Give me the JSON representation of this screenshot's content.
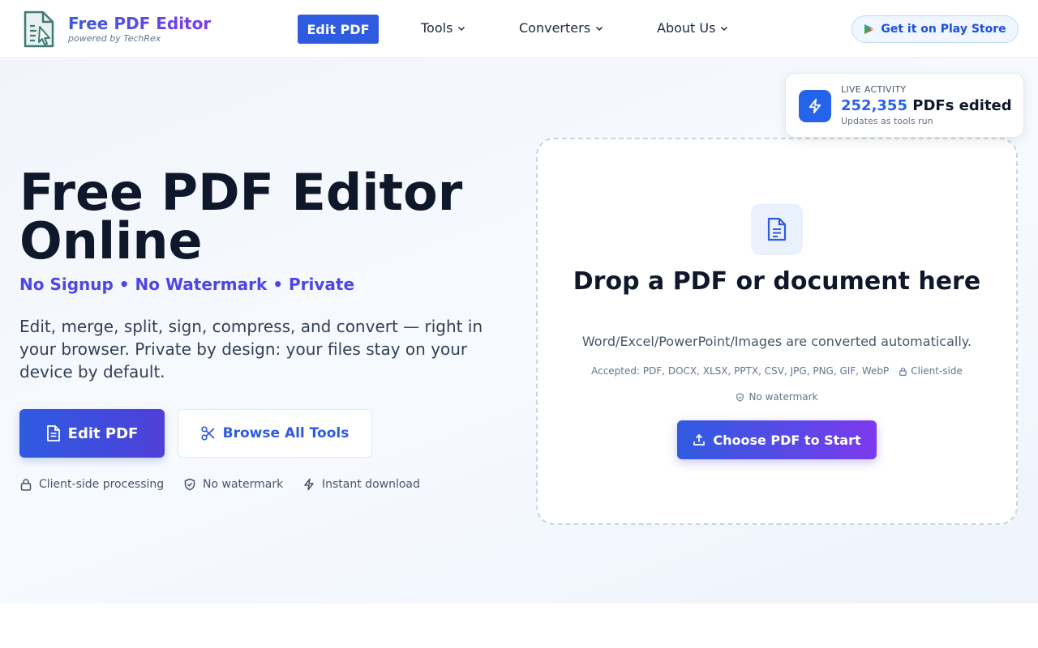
{
  "brand": {
    "title": "Free PDF Editor",
    "subtitle": "powered by TechRex"
  },
  "nav": {
    "edit_label": "Edit PDF",
    "items": [
      {
        "label": "Tools"
      },
      {
        "label": "Converters"
      },
      {
        "label": "About Us"
      }
    ],
    "play_store_label": "Get it on Play Store"
  },
  "hero": {
    "title": "Free PDF Editor Online",
    "tagline": "No Signup • No Watermark • Private",
    "description": "Edit, merge, split, sign, compress, and convert — right in your browser. Private by design: your files stay on your device by default.",
    "primary_button": "Edit PDF",
    "secondary_button": "Browse All Tools",
    "features": [
      {
        "label": "Client-side processing",
        "icon": "lock-icon"
      },
      {
        "label": "No watermark",
        "icon": "shield-check-icon"
      },
      {
        "label": "Instant download",
        "icon": "lightning-icon"
      }
    ]
  },
  "live_activity": {
    "label": "LIVE ACTIVITY",
    "count": "252,355",
    "count_suffix": "PDFs edited",
    "note": "Updates as tools run"
  },
  "dropzone": {
    "title": "Drop a PDF or document here",
    "subtitle": "Word/Excel/PowerPoint/Images are converted automatically.",
    "accepted": "Accepted: PDF, DOCX, XLSX, PPTX, CSV, JPG, PNG, GIF, WebP",
    "client_side": "Client-side",
    "no_watermark": "No watermark",
    "button": "Choose PDF to Start"
  },
  "colors": {
    "accent": "#2f5be0",
    "accent_purple": "#7c3aed",
    "tagline": "#4f46e5"
  }
}
